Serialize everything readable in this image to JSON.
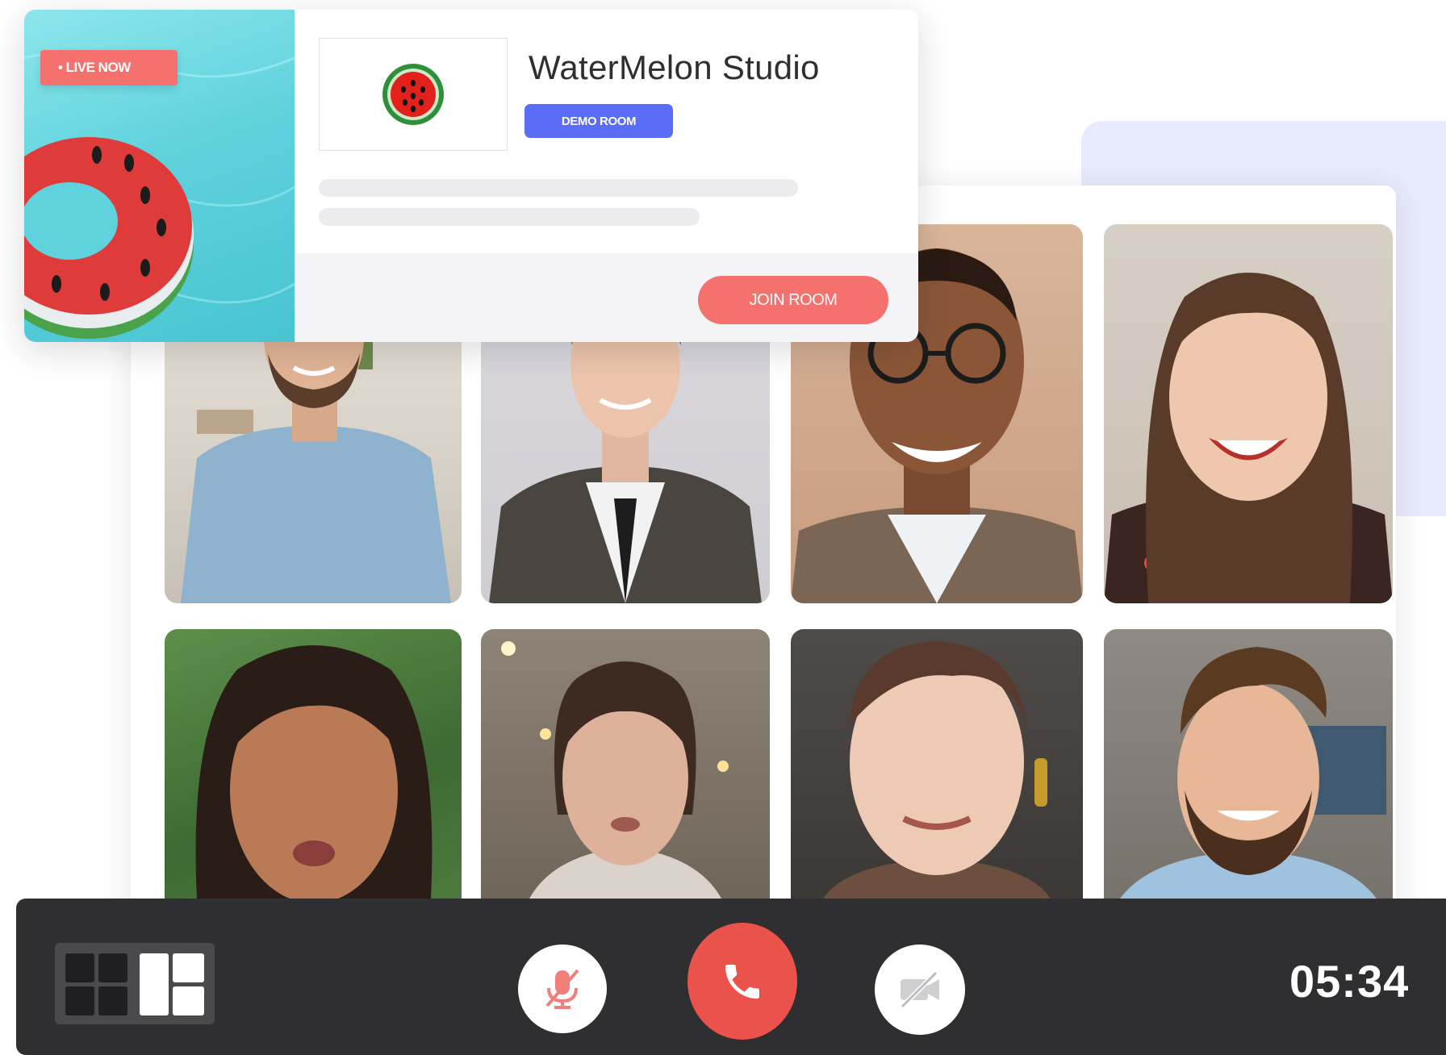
{
  "room": {
    "live_badge": "• LIVE NOW",
    "title": "WaterMelon Studio",
    "demo_label": "DEMO ROOM",
    "join_label": "JOIN ROOM"
  },
  "participants": [
    {
      "name": "participant-1"
    },
    {
      "name": "participant-2"
    },
    {
      "name": "participant-3"
    },
    {
      "name": "participant-4"
    },
    {
      "name": "participant-5"
    },
    {
      "name": "participant-6"
    },
    {
      "name": "participant-7"
    },
    {
      "name": "participant-8"
    }
  ],
  "controls": {
    "layout_icons": [
      "grid-layout-icon",
      "speaker-layout-icon"
    ],
    "mic_icon": "mic-muted-icon",
    "hangup_icon": "phone-icon",
    "camera_icon": "camera-off-icon",
    "timer": "05:34"
  },
  "colors": {
    "accent_red": "#f4716d",
    "hangup_red": "#ea524b",
    "demo_blue": "#5b6cf6",
    "control_bar": "#2f2f31"
  }
}
